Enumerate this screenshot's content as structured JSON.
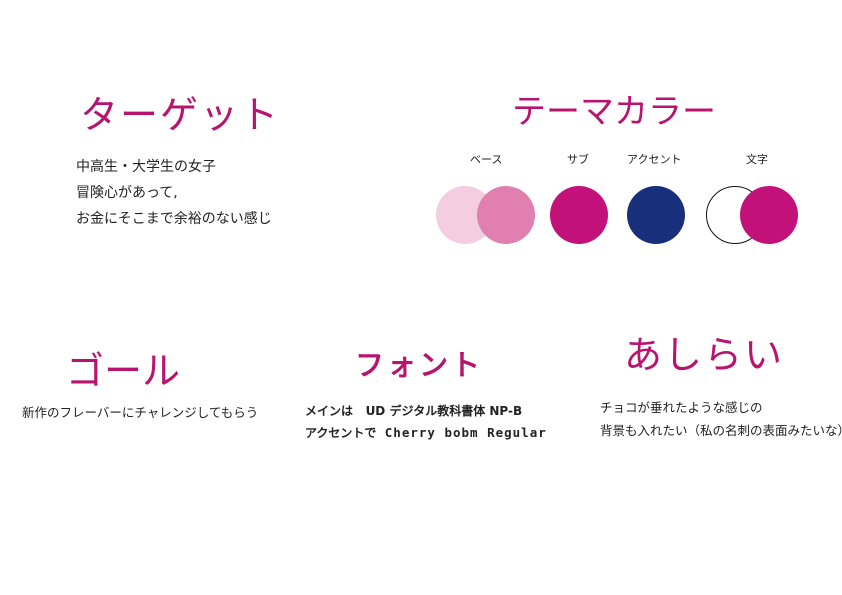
{
  "target": {
    "heading": "ターゲット",
    "lines": [
      "中高生・大学生の女子",
      "冒険心があって,",
      "お金にそこまで余裕のない感じ"
    ]
  },
  "theme_color": {
    "heading": "テーマカラー",
    "labels": {
      "base": "ベース",
      "sub": "サブ",
      "accent": "アクセント",
      "text": "文字"
    },
    "colors": {
      "base_light": "#f4cde1",
      "base_mid": "#e07fb0",
      "sub": "#c2127a",
      "accent": "#182f7b",
      "text_outline": "#111111",
      "text_fill": "#c2127a"
    }
  },
  "goal": {
    "heading": "ゴール",
    "text": "新作のフレーバーにチャレンジしてもらう"
  },
  "font": {
    "heading": "フォント",
    "main_label": "メインは",
    "main_font": "UD デジタル教科書体 NP-B",
    "accent_label": "アクセントで",
    "accent_font": "Cherry bobm Regular"
  },
  "ashirai": {
    "heading": "あしらい",
    "lines": [
      "チョコが垂れたような感じの",
      "背景も入れたい（私の名刺の表面みたいな）"
    ]
  }
}
